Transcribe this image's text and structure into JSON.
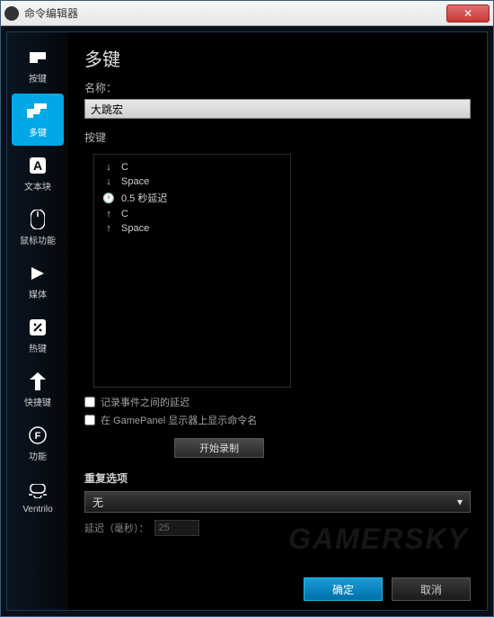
{
  "window": {
    "title": "命令编辑器",
    "close": "✕"
  },
  "sidebar": {
    "items": [
      {
        "label": "按键"
      },
      {
        "label": "多键"
      },
      {
        "label": "文本块"
      },
      {
        "label": "鼠标功能"
      },
      {
        "label": "媒体"
      },
      {
        "label": "热键"
      },
      {
        "label": "快捷键"
      },
      {
        "label": "功能"
      },
      {
        "label": "Ventrilo"
      }
    ]
  },
  "main": {
    "title": "多键",
    "name_label": "名称：",
    "name_value": "大跳宏",
    "keys_label": "按键",
    "keys": [
      {
        "dir": "down",
        "text": "C"
      },
      {
        "dir": "down",
        "text": "Space"
      },
      {
        "dir": "clock",
        "text": "0.5 秒延迟"
      },
      {
        "dir": "up",
        "text": "C"
      },
      {
        "dir": "up",
        "text": "Space"
      }
    ],
    "check1": "记录事件之间的延迟",
    "check2": "在 GamePanel 显示器上显示命令名",
    "record_btn": "开始录制",
    "repeat_title": "重复选项",
    "repeat_value": "无",
    "delay_label": "延迟（毫秒）：",
    "delay_value": "25"
  },
  "footer": {
    "ok": "确定",
    "cancel": "取消"
  },
  "watermark": "GAMERSKY"
}
